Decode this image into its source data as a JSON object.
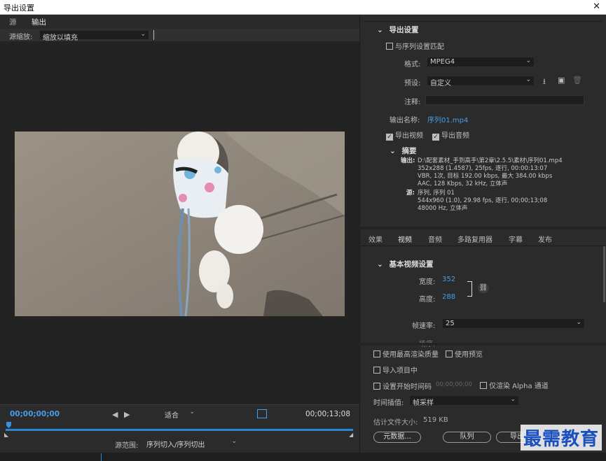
{
  "window": {
    "title": "导出设置",
    "close": "✕"
  },
  "left": {
    "tabs": [
      "源",
      "输出"
    ],
    "zoom_label": "源缩放:",
    "zoom_value": "缩放以填充",
    "timecode_in": "00;00;00;00",
    "timecode_out": "00;00;13;08",
    "fit_value": "适合",
    "range_label": "源范围:",
    "range_value": "序列切入/序列切出"
  },
  "export": {
    "header": "导出设置",
    "match_sequence": "与序列设置匹配",
    "format_label": "格式:",
    "format_value": "MPEG4",
    "preset_label": "预设:",
    "preset_value": "自定义",
    "comment_label": "注释:",
    "output_name_label": "输出名称:",
    "output_name_value": "序列01.mp4",
    "export_video": "导出视频",
    "export_audio": "导出音频",
    "summary_header": "摘要",
    "output_label": "输出:",
    "output_lines": [
      "D:\\配套素材_手到高手\\第2章\\2.5.5\\素材\\序列01.mp4",
      "352x288 (1.4587), 25fps, 逐行, 00:00:13:07",
      "VBR, 1次, 目标 192.00 kbps, 最大 384.00 kbps",
      "AAC, 128 Kbps, 32 kHz, 立体声"
    ],
    "source_label": "源:",
    "source_lines": [
      "序列, 序列 01",
      "544x960 (1.0), 29.98 fps, 逐行, 00;00;13;08",
      "48000 Hz, 立体声"
    ]
  },
  "tabs2": [
    "效果",
    "视频",
    "音频",
    "多路复用器",
    "字幕",
    "发布"
  ],
  "video": {
    "header": "基本视频设置",
    "width_label": "宽度:",
    "width_value": "352",
    "height_label": "高度:",
    "height_value": "288",
    "framerate_label": "帧速率:",
    "framerate_value": "25",
    "cut_label": "场序:"
  },
  "bottom": {
    "max_quality": "使用最高渲染质量",
    "use_preview": "使用预览",
    "import_project": "导入项目中",
    "set_timecode": "设置开始时间码",
    "timecode_placeholder": "00;00;00;00",
    "alpha_only": "仅渲染 Alpha 通道",
    "interp_label": "时间插值:",
    "interp_value": "帧采样",
    "filesize_label": "估计文件大小:",
    "filesize_value": "519 KB",
    "metadata_btn": "元数据...",
    "queue_btn": "队列",
    "export_btn": "导出"
  },
  "watermark": "最需教育"
}
